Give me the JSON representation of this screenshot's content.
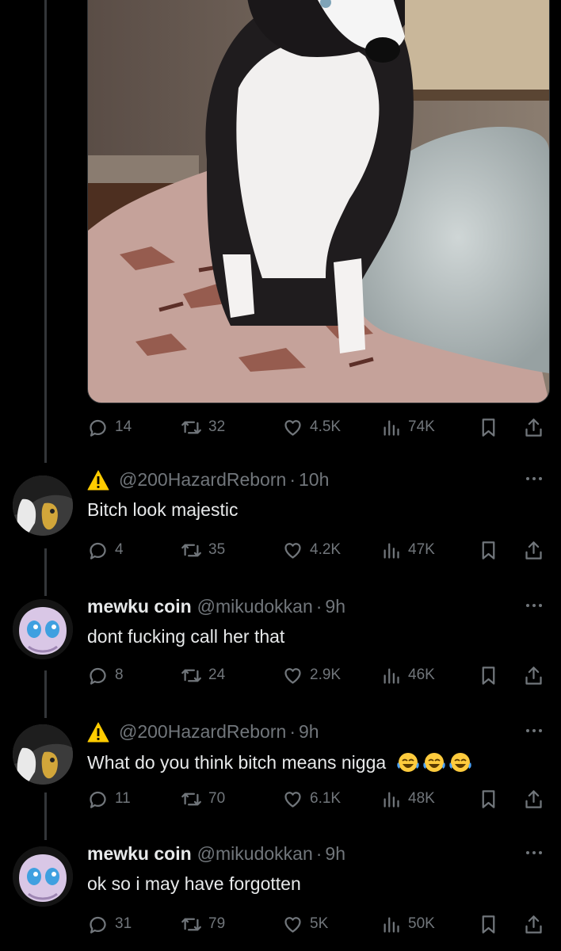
{
  "top_post": {
    "media": {
      "alt": "dog photo",
      "icon": "photo"
    },
    "stats": {
      "replies": "14",
      "reposts": "32",
      "likes": "4.5K",
      "views": "74K"
    }
  },
  "replies": [
    {
      "name": "",
      "handle": "@200HazardReborn",
      "time": "10h",
      "badge_icon": "warning-icon",
      "text": "Bitch look majestic",
      "stats": {
        "replies": "4",
        "reposts": "35",
        "likes": "4.2K",
        "views": "47K"
      }
    },
    {
      "name": "mewku coin",
      "handle": "@mikudokkan",
      "time": "9h",
      "text": "dont fucking call her that",
      "stats": {
        "replies": "8",
        "reposts": "24",
        "likes": "2.9K",
        "views": "46K"
      }
    },
    {
      "name": "",
      "handle": "@200HazardReborn",
      "time": "9h",
      "badge_icon": "warning-icon",
      "text": "What do you think bitch means nigga",
      "emoji": [
        "tears-of-joy-emoji",
        "tears-of-joy-emoji",
        "tears-of-joy-emoji"
      ],
      "stats": {
        "replies": "11",
        "reposts": "70",
        "likes": "6.1K",
        "views": "48K"
      }
    },
    {
      "name": "mewku coin",
      "handle": "@mikudokkan",
      "time": "9h",
      "text": "ok so i may have forgotten",
      "stats": {
        "replies": "31",
        "reposts": "79",
        "likes": "5K",
        "views": "50K"
      }
    }
  ],
  "colors": {
    "background": "#000000",
    "text": "#e7e9ea",
    "muted": "#71767b",
    "divider": "#333639"
  }
}
